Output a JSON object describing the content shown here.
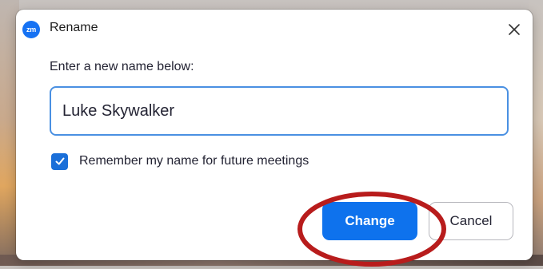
{
  "dialog": {
    "app_logo_text": "zm",
    "title": "Rename",
    "prompt": "Enter a new name below:",
    "name_value": "Luke Skywalker",
    "remember_label": "Remember my name for future meetings",
    "remember_checked": true,
    "change_label": "Change",
    "cancel_label": "Cancel"
  },
  "icons": {
    "close": "close-icon",
    "check": "checkmark-icon",
    "logo": "zoom-logo-icon"
  },
  "colors": {
    "accent": "#0e72ed",
    "checkbox": "#1a6fd9",
    "input_border": "#4a90e2",
    "annotation": "#b81c1c"
  }
}
